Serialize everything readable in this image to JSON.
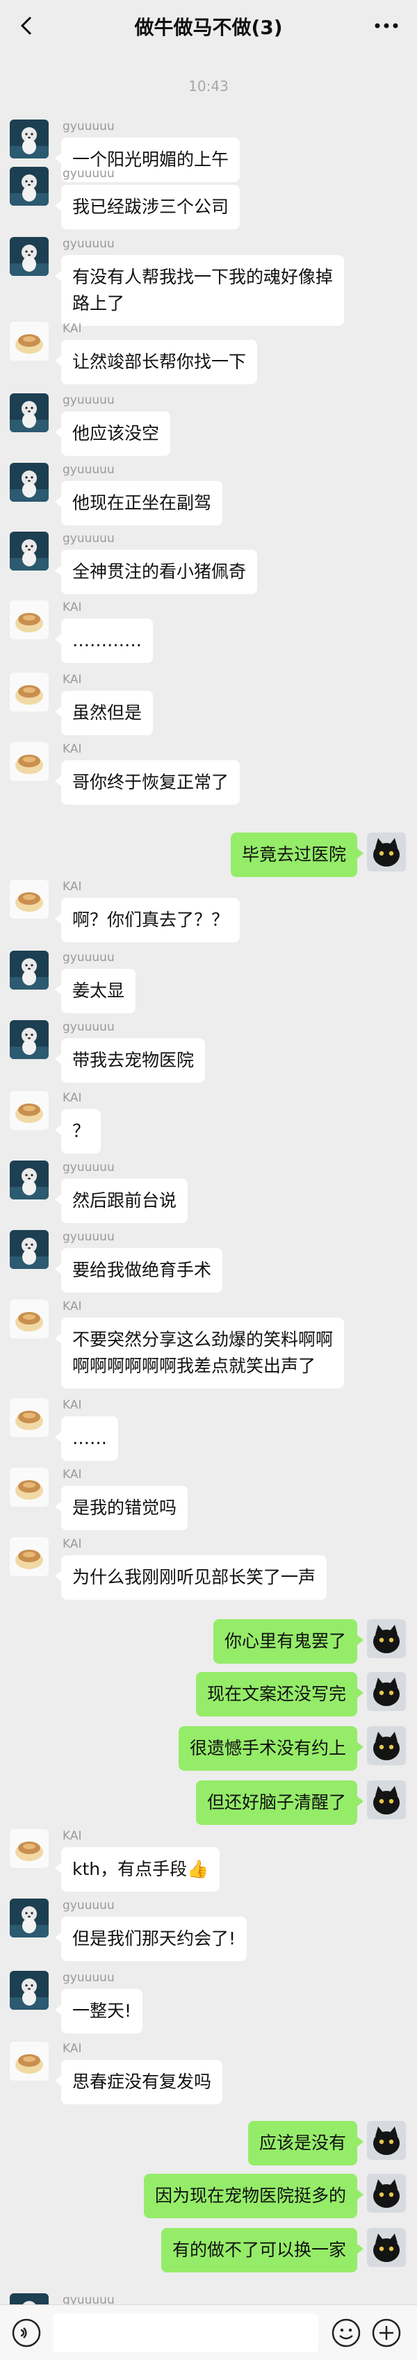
{
  "header": {
    "title": "做牛做马不做(3)",
    "back_icon": "chevron-left-icon",
    "more_icon": "more-dots-icon"
  },
  "time_label": "10:43",
  "messages": [
    {
      "side": "left",
      "sender": "gyuuuuu",
      "text": "一个阳光明媚的上午",
      "avatar": "dog-avatar"
    },
    {
      "side": "left",
      "sender": "gyuuuuu",
      "text": "我已经跋涉三个公司",
      "avatar": "dog-avatar"
    },
    {
      "side": "left",
      "sender": "gyuuuuu",
      "text": "有没有人帮我找一下我的魂好像掉\n路上了",
      "avatar": "dog-avatar"
    },
    {
      "side": "left",
      "sender": "KAI",
      "text": "让然竣部长帮你找一下",
      "avatar": "bun-avatar"
    },
    {
      "side": "left",
      "sender": "gyuuuuu",
      "text": "他应该没空",
      "avatar": "dog-avatar"
    },
    {
      "side": "left",
      "sender": "gyuuuuu",
      "text": "他现在正坐在副驾",
      "avatar": "dog-avatar"
    },
    {
      "side": "left",
      "sender": "gyuuuuu",
      "text": "全神贯注的看小猪佩奇",
      "avatar": "dog-avatar"
    },
    {
      "side": "left",
      "sender": "KAI",
      "text": "…………",
      "avatar": "bun-avatar"
    },
    {
      "side": "left",
      "sender": "KAI",
      "text": "虽然但是",
      "avatar": "bun-avatar"
    },
    {
      "side": "left",
      "sender": "KAI",
      "text": "哥你终于恢复正常了",
      "avatar": "bun-avatar"
    },
    {
      "side": "right",
      "sender": "",
      "text": "毕竟去过医院",
      "avatar": "cat-avatar"
    },
    {
      "side": "left",
      "sender": "KAI",
      "text": "啊？你们真去了？？",
      "avatar": "bun-avatar"
    },
    {
      "side": "left",
      "sender": "gyuuuuu",
      "text": "姜太显",
      "avatar": "dog-avatar"
    },
    {
      "side": "left",
      "sender": "gyuuuuu",
      "text": "带我去宠物医院",
      "avatar": "dog-avatar"
    },
    {
      "side": "left",
      "sender": "KAI",
      "text": "？",
      "avatar": "bun-avatar"
    },
    {
      "side": "left",
      "sender": "gyuuuuu",
      "text": "然后跟前台说",
      "avatar": "dog-avatar"
    },
    {
      "side": "left",
      "sender": "gyuuuuu",
      "text": "要给我做绝育手术",
      "avatar": "dog-avatar"
    },
    {
      "side": "left",
      "sender": "KAI",
      "text": "不要突然分享这么劲爆的笑料啊啊\n啊啊啊啊啊啊我差点就笑出声了",
      "avatar": "bun-avatar"
    },
    {
      "side": "left",
      "sender": "KAI",
      "text": "……",
      "avatar": "bun-avatar"
    },
    {
      "side": "left",
      "sender": "KAI",
      "text": "是我的错觉吗",
      "avatar": "bun-avatar"
    },
    {
      "side": "left",
      "sender": "KAI",
      "text": "为什么我刚刚听见部长笑了一声",
      "avatar": "bun-avatar"
    },
    {
      "side": "right",
      "sender": "",
      "text": "你心里有鬼罢了",
      "avatar": "cat-avatar"
    },
    {
      "side": "right",
      "sender": "",
      "text": "现在文案还没写完",
      "avatar": "cat-avatar"
    },
    {
      "side": "right",
      "sender": "",
      "text": "很遗憾手术没有约上",
      "avatar": "cat-avatar"
    },
    {
      "side": "right",
      "sender": "",
      "text": "但还好脑子清醒了",
      "avatar": "cat-avatar"
    },
    {
      "side": "left",
      "sender": "KAI",
      "text": "kth，有点手段👍",
      "avatar": "bun-avatar"
    },
    {
      "side": "left",
      "sender": "gyuuuuu",
      "text": "但是我们那天约会了!",
      "avatar": "dog-avatar"
    },
    {
      "side": "left",
      "sender": "gyuuuuu",
      "text": "一整天!",
      "avatar": "dog-avatar"
    },
    {
      "side": "left",
      "sender": "KAI",
      "text": "思春症没有复发吗",
      "avatar": "bun-avatar"
    },
    {
      "side": "right",
      "sender": "",
      "text": "应该是没有",
      "avatar": "cat-avatar"
    },
    {
      "side": "right",
      "sender": "",
      "text": "因为现在宠物医院挺多的",
      "avatar": "cat-avatar"
    },
    {
      "side": "right",
      "sender": "",
      "text": "有的做不了可以换一家",
      "avatar": "cat-avatar"
    },
    {
      "side": "left",
      "sender": "gyuuuuu",
      "text": "",
      "avatar": "dog-avatar"
    }
  ],
  "input_bar": {
    "placeholder": "",
    "voice_icon": "voice-icon",
    "emoji_icon": "emoji-icon",
    "plus_icon": "plus-icon"
  },
  "colors": {
    "background": "#ededed",
    "my_bubble": "#95ec69",
    "other_bubble": "#ffffff"
  }
}
